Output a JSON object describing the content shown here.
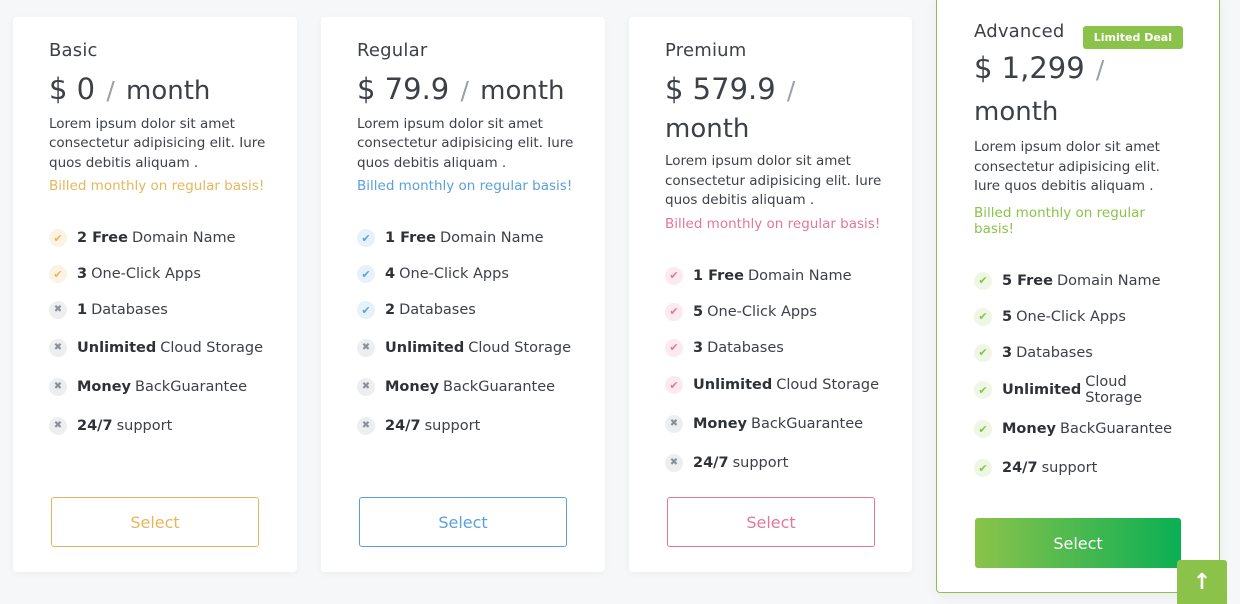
{
  "colors": {
    "basic": "#e5b75a",
    "regular": "#5aa0dc",
    "premium": "#e3769c",
    "advanced": "#8bc34a",
    "advanced_gradient_end": "#0aaf54"
  },
  "plans": [
    {
      "name": "Basic",
      "price": "$ 0",
      "sep": "/",
      "per": "month",
      "description": "Lorem ipsum dolor sit amet consectetur adipisicing elit. Iure quos debitis aliquam .",
      "billed": "Billed monthly on regular basis!",
      "button": "Select",
      "features": [
        {
          "bold": "2 Free",
          "text": "Domain Name",
          "included": true
        },
        {
          "bold": "3",
          "text": "One-Click Apps",
          "included": true
        },
        {
          "bold": "1",
          "text": "Databases",
          "included": false
        },
        {
          "bold": "Unlimited",
          "text": "Cloud Storage",
          "included": false
        },
        {
          "bold": "Money",
          "text": "BackGuarantee",
          "included": false
        },
        {
          "bold": "24/7",
          "text": "support",
          "included": false
        }
      ]
    },
    {
      "name": "Regular",
      "price": "$ 79.9",
      "sep": "/",
      "per": "month",
      "description": "Lorem ipsum dolor sit amet consectetur adipisicing elit. Iure quos debitis aliquam .",
      "billed": "Billed monthly on regular basis!",
      "button": "Select",
      "features": [
        {
          "bold": "1 Free",
          "text": "Domain Name",
          "included": true
        },
        {
          "bold": "4",
          "text": "One-Click Apps",
          "included": true
        },
        {
          "bold": "2",
          "text": "Databases",
          "included": true
        },
        {
          "bold": "Unlimited",
          "text": "Cloud Storage",
          "included": false
        },
        {
          "bold": "Money",
          "text": "BackGuarantee",
          "included": false
        },
        {
          "bold": "24/7",
          "text": "support",
          "included": false
        }
      ]
    },
    {
      "name": "Premium",
      "price": "$ 579.9",
      "sep": "/",
      "per": "month",
      "description": "Lorem ipsum dolor sit amet consectetur adipisicing elit. Iure quos debitis aliquam .",
      "billed": "Billed monthly on regular basis!",
      "button": "Select",
      "features": [
        {
          "bold": "1 Free",
          "text": "Domain Name",
          "included": true
        },
        {
          "bold": "5",
          "text": "One-Click Apps",
          "included": true
        },
        {
          "bold": "3",
          "text": "Databases",
          "included": true
        },
        {
          "bold": "Unlimited",
          "text": "Cloud Storage",
          "included": true
        },
        {
          "bold": "Money",
          "text": "BackGuarantee",
          "included": false
        },
        {
          "bold": "24/7",
          "text": "support",
          "included": false
        }
      ]
    },
    {
      "name": "Advanced",
      "badge": "Limited Deal",
      "price": "$ 1,299",
      "sep": "/",
      "per": "month",
      "description": "Lorem ipsum dolor sit amet consectetur adipisicing elit. Iure quos debitis aliquam .",
      "billed": "Billed monthly on regular basis!",
      "button": "Select",
      "features": [
        {
          "bold": "5 Free",
          "text": "Domain Name",
          "included": true
        },
        {
          "bold": "5",
          "text": "One-Click Apps",
          "included": true
        },
        {
          "bold": "3",
          "text": "Databases",
          "included": true
        },
        {
          "bold": "Unlimited",
          "text": "Cloud Storage",
          "included": true
        },
        {
          "bold": "Money",
          "text": "BackGuarantee",
          "included": true
        },
        {
          "bold": "24/7",
          "text": "support",
          "included": true
        }
      ]
    }
  ],
  "scroll_top": {
    "icon": "arrow-up-icon",
    "glyph": "↑"
  }
}
